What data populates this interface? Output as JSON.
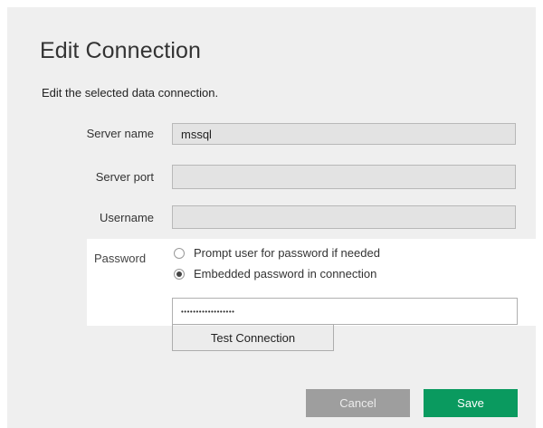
{
  "dialog": {
    "title": "Edit Connection",
    "subtitle": "Edit the selected data connection."
  },
  "fields": {
    "server_name": {
      "label": "Server name",
      "value": "mssql"
    },
    "server_port": {
      "label": "Server port",
      "value": ""
    },
    "username": {
      "label": "Username",
      "value": ""
    }
  },
  "password": {
    "label": "Password",
    "options": [
      {
        "label": "Prompt user for password if needed",
        "checked": false
      },
      {
        "label": "Embedded password in connection",
        "checked": true
      }
    ],
    "value": "••••••••••••••••••"
  },
  "buttons": {
    "test_label": "Test Connection",
    "cancel_label": "Cancel",
    "save_label": "Save"
  },
  "colors": {
    "dialog_bg": "#efefef",
    "save_green": "#0a9a5f",
    "cancel_gray": "#9e9e9e"
  }
}
